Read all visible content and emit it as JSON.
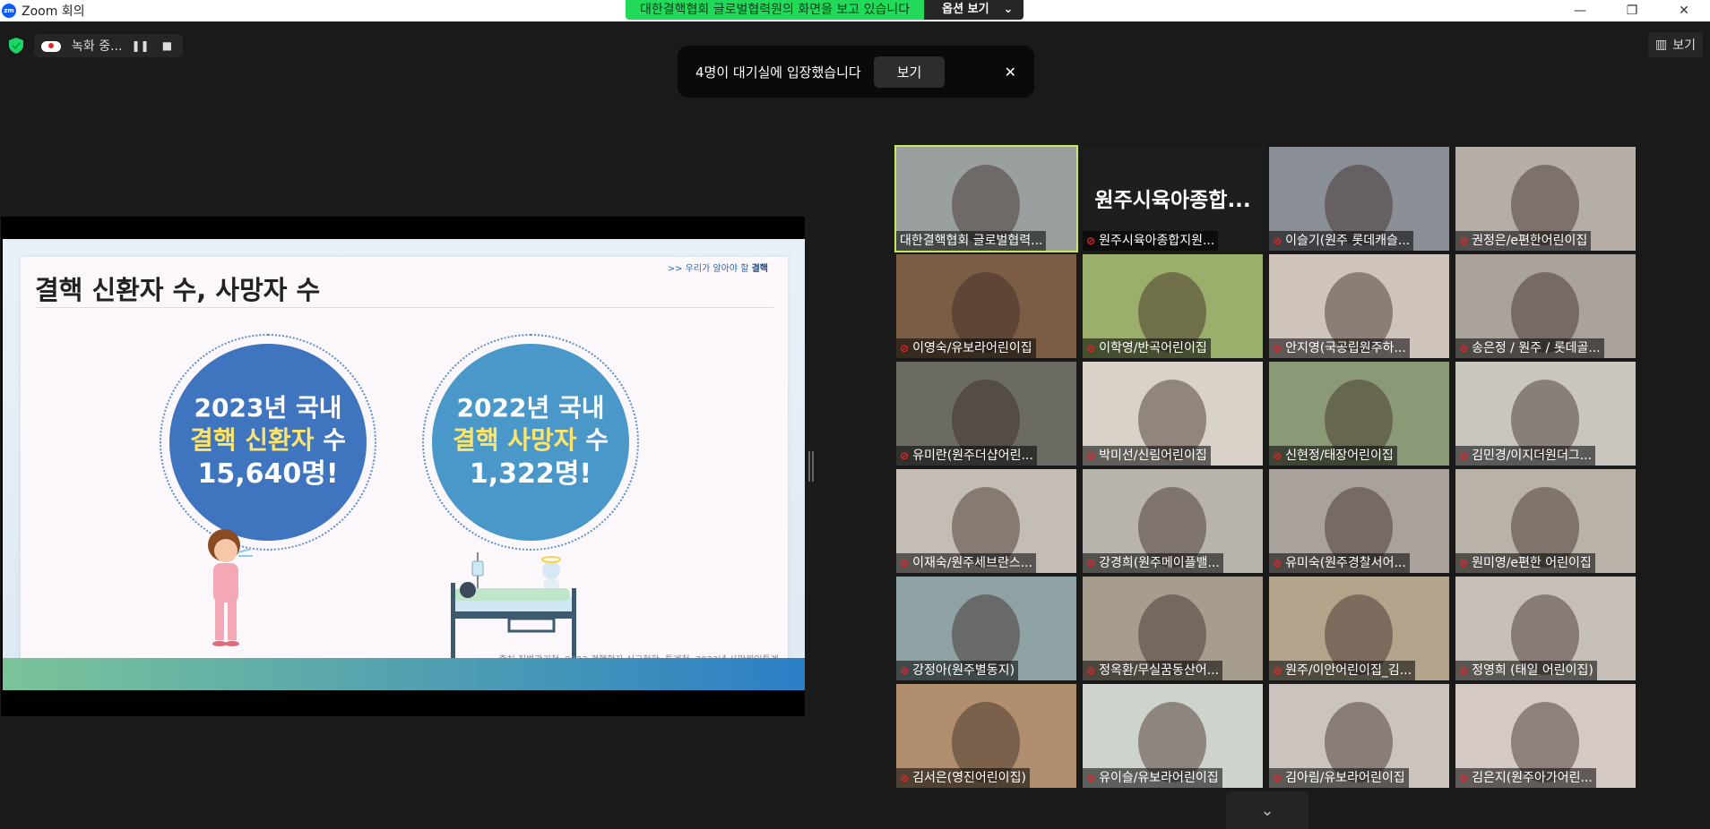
{
  "window": {
    "logo_text": "zm",
    "title": "Zoom 회의",
    "minimize": "—",
    "restore": "❐",
    "close": "✕"
  },
  "share_banner": {
    "text": "대한결핵협회 글로벌협력원의 화면을 보고 있습니다",
    "options_label": "옵션 보기",
    "options_chevron": "⌄"
  },
  "recording": {
    "label": "녹화 중...",
    "pause": "❚❚",
    "stop": "■"
  },
  "view_button": {
    "icon": "▥",
    "label": "보기"
  },
  "waiting_room": {
    "message": "4명이 대기실에 입장했습니다",
    "view_label": "보기",
    "close": "✕"
  },
  "slide": {
    "tag_prefix": ">> 우리가 알아야 할 ",
    "tag_bold": "결핵",
    "title": "결핵 신환자 수, 사망자 수",
    "circle1": {
      "line1": "2023년 국내",
      "line2_hl": "결핵 신환자",
      "line2_rest": " 수",
      "line3": "15,640명!"
    },
    "circle2": {
      "line1": "2022년 국내",
      "line2_hl": "결핵 사망자",
      "line2_rest": " 수",
      "line3": "1,322명!"
    },
    "source": "출처 질병관리청, 2023 결핵환자 신고현황, 통계청, 2022년 사망원인통계"
  },
  "participants": [
    {
      "name": "대한결핵협회 글로벌협력...",
      "muted": false,
      "bg": "#9aa0a0",
      "active": true
    },
    {
      "name": "원주시육아종합지원...",
      "muted": true,
      "bg": "#1e1e1e",
      "big_name": "원주시육아종합..."
    },
    {
      "name": "이슬기(원주 롯데캐슬...",
      "muted": true,
      "bg": "#8a8f96"
    },
    {
      "name": "권정은/e편한어린이집",
      "muted": true,
      "bg": "#b5aea6"
    },
    {
      "name": "이영숙/유보라어린이집",
      "muted": true,
      "bg": "#7b5d46"
    },
    {
      "name": "이학영/반곡어린이집",
      "muted": true,
      "bg": "#9cae6b"
    },
    {
      "name": "안지영(국공립원주하...",
      "muted": true,
      "bg": "#cfc4bc"
    },
    {
      "name": "송은정 / 원주 / 롯데골...",
      "muted": true,
      "bg": "#a9a39b"
    },
    {
      "name": "유미란(원주더샵어린...",
      "muted": true,
      "bg": "#6c6b63"
    },
    {
      "name": "박미선/신림어린이집",
      "muted": true,
      "bg": "#d9d2c8"
    },
    {
      "name": "신현정/태장어린이집",
      "muted": true,
      "bg": "#8a9a76"
    },
    {
      "name": "김민경/이지더원더그...",
      "muted": true,
      "bg": "#c9c6c0"
    },
    {
      "name": "이재숙/원주세브란스...",
      "muted": true,
      "bg": "#c4bdb5"
    },
    {
      "name": "강경희(원주메이플밸...",
      "muted": true,
      "bg": "#b8b3ac"
    },
    {
      "name": "유미숙(원주경찰서어...",
      "muted": true,
      "bg": "#a8a19c"
    },
    {
      "name": "원미영/e편한 어린이집",
      "muted": true,
      "bg": "#b9b2a9"
    },
    {
      "name": "강정아(원주별동지)",
      "muted": true,
      "bg": "#8fa3a4"
    },
    {
      "name": "정옥환/무실꿈동산어...",
      "muted": true,
      "bg": "#a79d8c"
    },
    {
      "name": "원주/이안어린이집_김...",
      "muted": true,
      "bg": "#b2a58c"
    },
    {
      "name": "정영희 (태일 어린이집)",
      "muted": true,
      "bg": "#c7c0b8"
    },
    {
      "name": "김서은(영진어린이집)",
      "muted": true,
      "bg": "#b08e6e"
    },
    {
      "name": "유이슬/유보라어린이집",
      "muted": true,
      "bg": "#cfd3cd"
    },
    {
      "name": "김아림/유보라어린이집",
      "muted": true,
      "bg": "#cbc4be"
    },
    {
      "name": "김은지(원주아가어린...",
      "muted": true,
      "bg": "#d4c9c4"
    }
  ],
  "scroll_down": "⌄"
}
